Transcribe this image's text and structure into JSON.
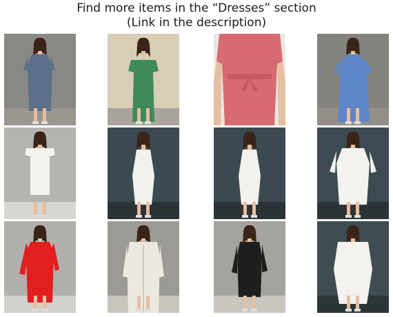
{
  "header": {
    "line1": "Find more items in the “Dresses” section",
    "line2": "(Link in the description)"
  },
  "grid": [
    {
      "id": "p1",
      "dress": "#5b7089",
      "bg": "#8a8884",
      "floor": "#9a9690",
      "style": "shift"
    },
    {
      "id": "p2",
      "dress": "#3f8a5a",
      "bg": "#d9cdb6",
      "floor": "#a9a59c",
      "style": "offshoulder"
    },
    {
      "id": "p3",
      "dress": "#d86a72",
      "bg": "#e9e7e4",
      "floor": "#e9e7e4",
      "style": "closeup"
    },
    {
      "id": "p4",
      "dress": "#5f86c8",
      "bg": "#85837e",
      "floor": "#938f88",
      "style": "long"
    },
    {
      "id": "p5",
      "dress": "#f4f2ee",
      "bg": "#b4b3af",
      "floor": "#d8d6d2",
      "style": "ruffle"
    },
    {
      "id": "p6",
      "dress": "#f2f1ec",
      "bg": "#3a4a50",
      "floor": "#2b3337",
      "style": "slip"
    },
    {
      "id": "p7",
      "dress": "#f2f1ec",
      "bg": "#3a4a50",
      "floor": "#2b3337",
      "style": "slip"
    },
    {
      "id": "p8",
      "dress": "#f3f2ee",
      "bg": "#3c4b51",
      "floor": "#2b3337",
      "style": "loose"
    },
    {
      "id": "p9",
      "dress": "#e11f1f",
      "bg": "#b1b0ac",
      "floor": "#d3d1cd",
      "style": "red"
    },
    {
      "id": "p10",
      "dress": "#ece8df",
      "bg": "#9c9a95",
      "floor": "#c8c5bf",
      "style": "coat"
    },
    {
      "id": "p11",
      "dress": "#1e1e1e",
      "bg": "#a5a39f",
      "floor": "#c9c6c0",
      "style": "black"
    },
    {
      "id": "p12",
      "dress": "#f3f2ee",
      "bg": "#3f4d53",
      "floor": "#2d3539",
      "style": "cape"
    }
  ]
}
